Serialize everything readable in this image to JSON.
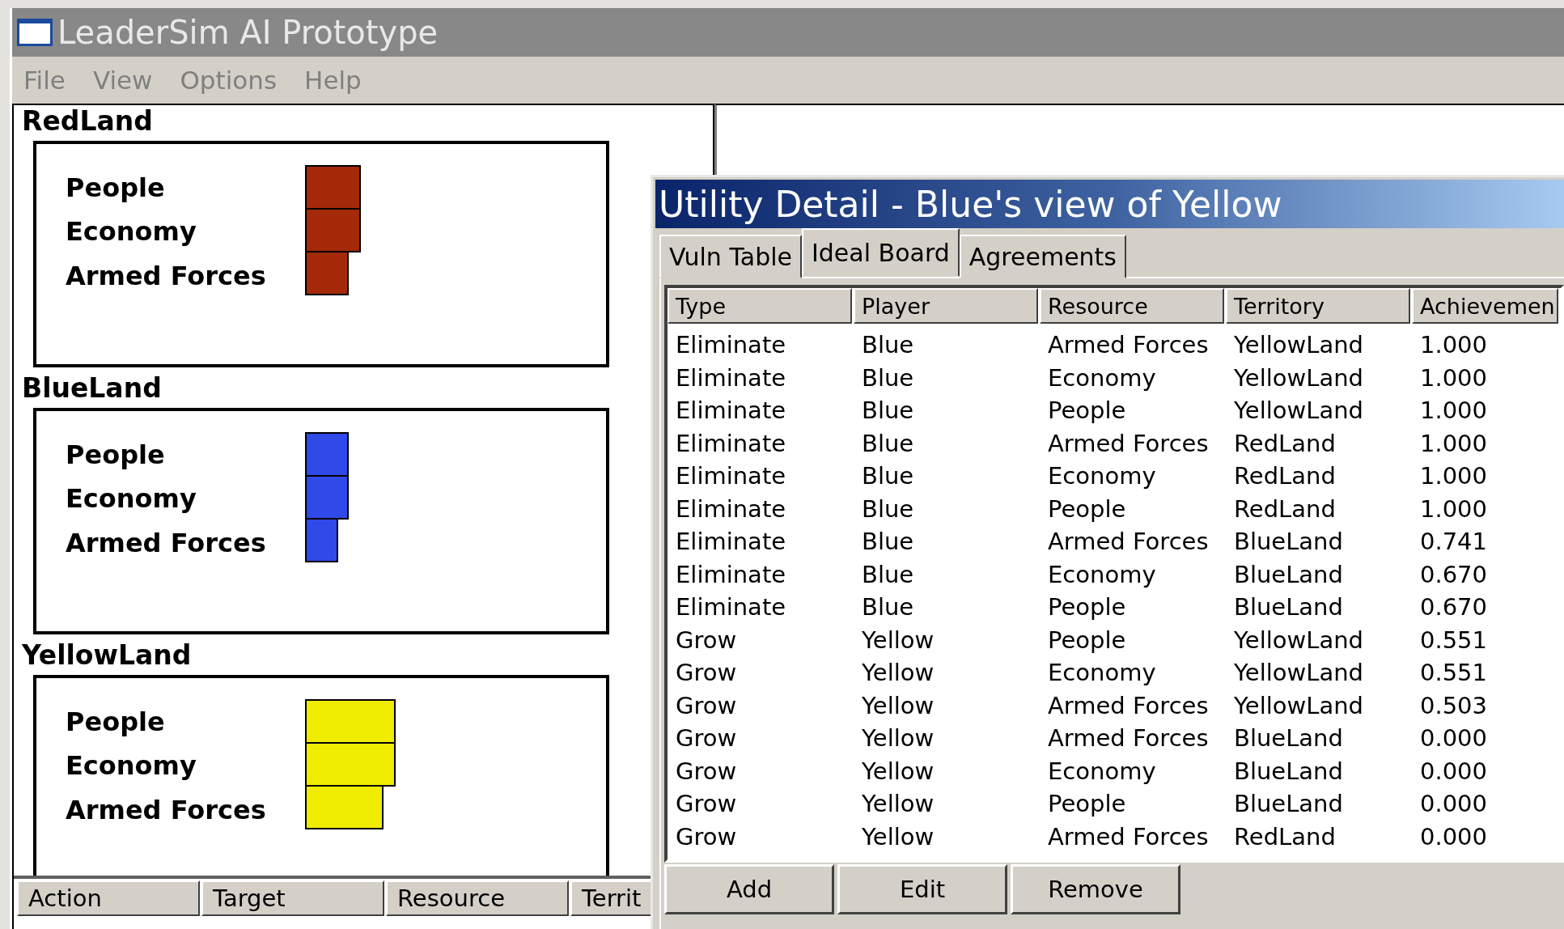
{
  "window": {
    "title": "LeaderSim AI Prototype"
  },
  "menu": [
    "File",
    "View",
    "Options",
    "Help"
  ],
  "lands": [
    {
      "name": "RedLand",
      "color": "#a52a0a",
      "bars": [
        {
          "label": "People"
        },
        {
          "label": "Economy"
        },
        {
          "label": "Armed Forces"
        }
      ]
    },
    {
      "name": "BlueLand",
      "color": "#2f4ae8",
      "bars": [
        {
          "label": "People"
        },
        {
          "label": "Economy"
        },
        {
          "label": "Armed Forces"
        }
      ]
    },
    {
      "name": "YellowLand",
      "color": "#f0ec00",
      "bars": [
        {
          "label": "People"
        },
        {
          "label": "Economy"
        },
        {
          "label": "Armed Forces"
        }
      ]
    }
  ],
  "action_table": {
    "columns": [
      "Action",
      "Target",
      "Resource",
      "Territ"
    ]
  },
  "dialog": {
    "title": "Utility Detail - Blue's view of Yellow",
    "tabs": [
      {
        "label": "Vuln Table",
        "selected": false
      },
      {
        "label": "Ideal Board",
        "selected": true
      },
      {
        "label": "Agreements",
        "selected": false
      }
    ],
    "columns": [
      "Type",
      "Player",
      "Resource",
      "Territory",
      "Achievemen"
    ],
    "rows": [
      [
        "Eliminate",
        "Blue",
        "Armed Forces",
        "YellowLand",
        "1.000"
      ],
      [
        "Eliminate",
        "Blue",
        "Economy",
        "YellowLand",
        "1.000"
      ],
      [
        "Eliminate",
        "Blue",
        "People",
        "YellowLand",
        "1.000"
      ],
      [
        "Eliminate",
        "Blue",
        "Armed Forces",
        "RedLand",
        "1.000"
      ],
      [
        "Eliminate",
        "Blue",
        "Economy",
        "RedLand",
        "1.000"
      ],
      [
        "Eliminate",
        "Blue",
        "People",
        "RedLand",
        "1.000"
      ],
      [
        "Eliminate",
        "Blue",
        "Armed Forces",
        "BlueLand",
        "0.741"
      ],
      [
        "Eliminate",
        "Blue",
        "Economy",
        "BlueLand",
        "0.670"
      ],
      [
        "Eliminate",
        "Blue",
        "People",
        "BlueLand",
        "0.670"
      ],
      [
        "Grow",
        "Yellow",
        "People",
        "YellowLand",
        "0.551"
      ],
      [
        "Grow",
        "Yellow",
        "Economy",
        "YellowLand",
        "0.551"
      ],
      [
        "Grow",
        "Yellow",
        "Armed Forces",
        "YellowLand",
        "0.503"
      ],
      [
        "Grow",
        "Yellow",
        "Armed Forces",
        "BlueLand",
        "0.000"
      ],
      [
        "Grow",
        "Yellow",
        "Economy",
        "BlueLand",
        "0.000"
      ],
      [
        "Grow",
        "Yellow",
        "People",
        "BlueLand",
        "0.000"
      ],
      [
        "Grow",
        "Yellow",
        "Armed Forces",
        "RedLand",
        "0.000"
      ]
    ],
    "buttons": [
      "Add",
      "Edit",
      "Remove"
    ]
  }
}
